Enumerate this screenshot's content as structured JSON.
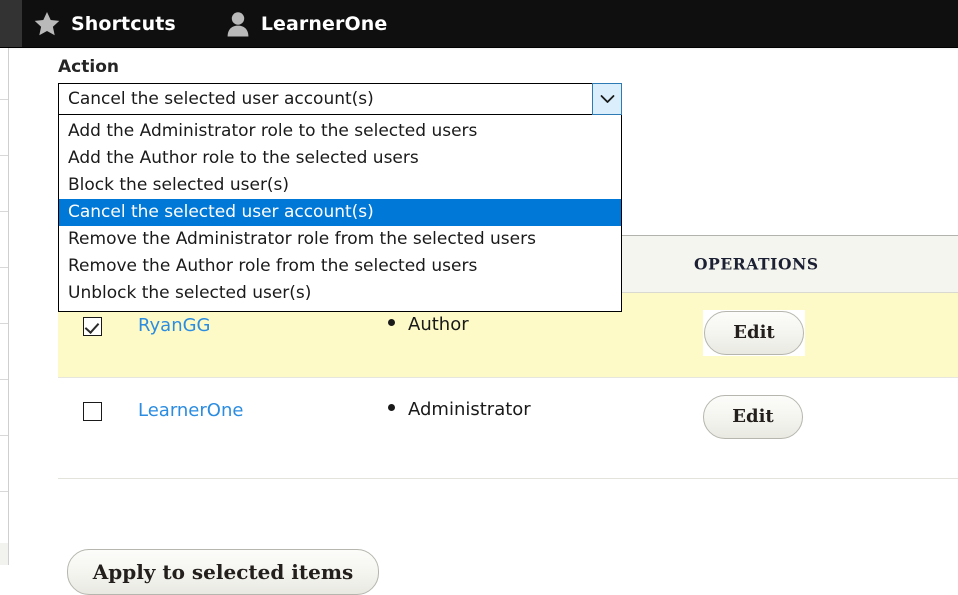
{
  "toolbar": {
    "items": [
      {
        "label": "Shortcuts",
        "icon": "star-icon"
      },
      {
        "label": "LearnerOne",
        "icon": "user-icon"
      }
    ]
  },
  "form": {
    "action_label": "Action",
    "select": {
      "value": "Cancel the selected user account(s)",
      "expanded": true,
      "arrow_icon": "chevron-down-icon",
      "options": [
        "Add the Administrator role to the selected users",
        "Add the Author role to the selected users",
        "Block the selected user(s)",
        "Cancel the selected user account(s)",
        "Remove the Administrator role from the selected users",
        "Remove the Author role from the selected users",
        "Unblock the selected user(s)"
      ],
      "selected_index": 3
    },
    "apply_label": "Apply to selected items"
  },
  "table": {
    "headers": {
      "operations": "OPERATIONS"
    },
    "rows": [
      {
        "checked": true,
        "username": "RyanGG",
        "role": "Author",
        "operation_label": "Edit",
        "highlighted": true,
        "focused": true
      },
      {
        "checked": false,
        "username": "LearnerOne",
        "role": "Administrator",
        "operation_label": "Edit",
        "highlighted": false,
        "focused": false
      }
    ]
  },
  "colors": {
    "toolbar_bg": "#0f0f0f",
    "toolbar_left_bg": "#333333",
    "option_highlight": "#0078d7",
    "row_highlight": "#fdfac8",
    "link": "#2b8ce0",
    "select_arrow_bg": "#dbeefb"
  }
}
